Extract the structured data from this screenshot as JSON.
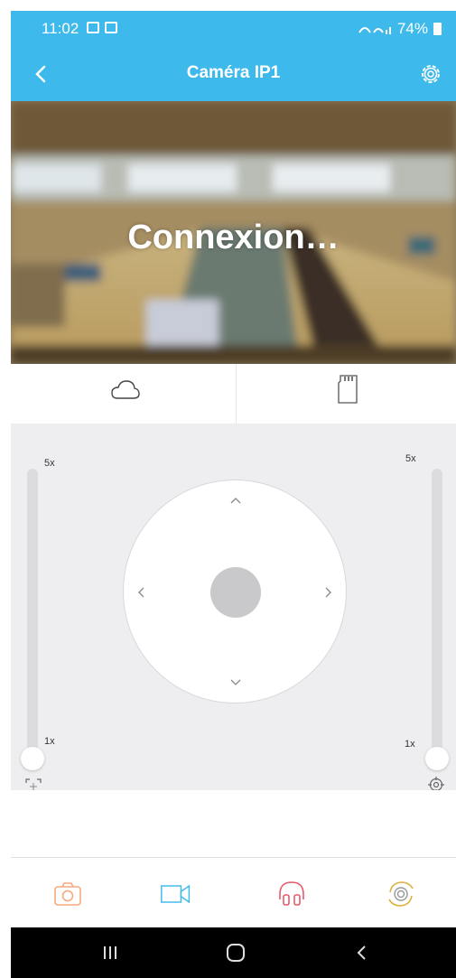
{
  "status_bar": {
    "time": "11:02",
    "battery": "74%"
  },
  "app_bar": {
    "title": "Caméra IP1"
  },
  "video": {
    "overlay_text": "Connexion…"
  },
  "ptz": {
    "left_zoom": {
      "max_label": "5x",
      "min_label": "1x",
      "level": 0
    },
    "right_zoom": {
      "max_label": "5x",
      "min_label": "1x",
      "level": 0
    }
  },
  "icons": {
    "back": "chevron-left-icon",
    "settings": "gear-icon",
    "cloud": "cloud-icon",
    "sd_card": "sd-card-icon",
    "snapshot": "camera-icon",
    "record": "video-camera-icon",
    "audio": "headphones-icon",
    "cruise": "rotate-camera-icon"
  },
  "colors": {
    "accent": "#3db9ec",
    "snapshot": "#f5a97f",
    "record": "#3db9ec",
    "audio": "#e85a6a",
    "cruise": "#e0b040"
  }
}
